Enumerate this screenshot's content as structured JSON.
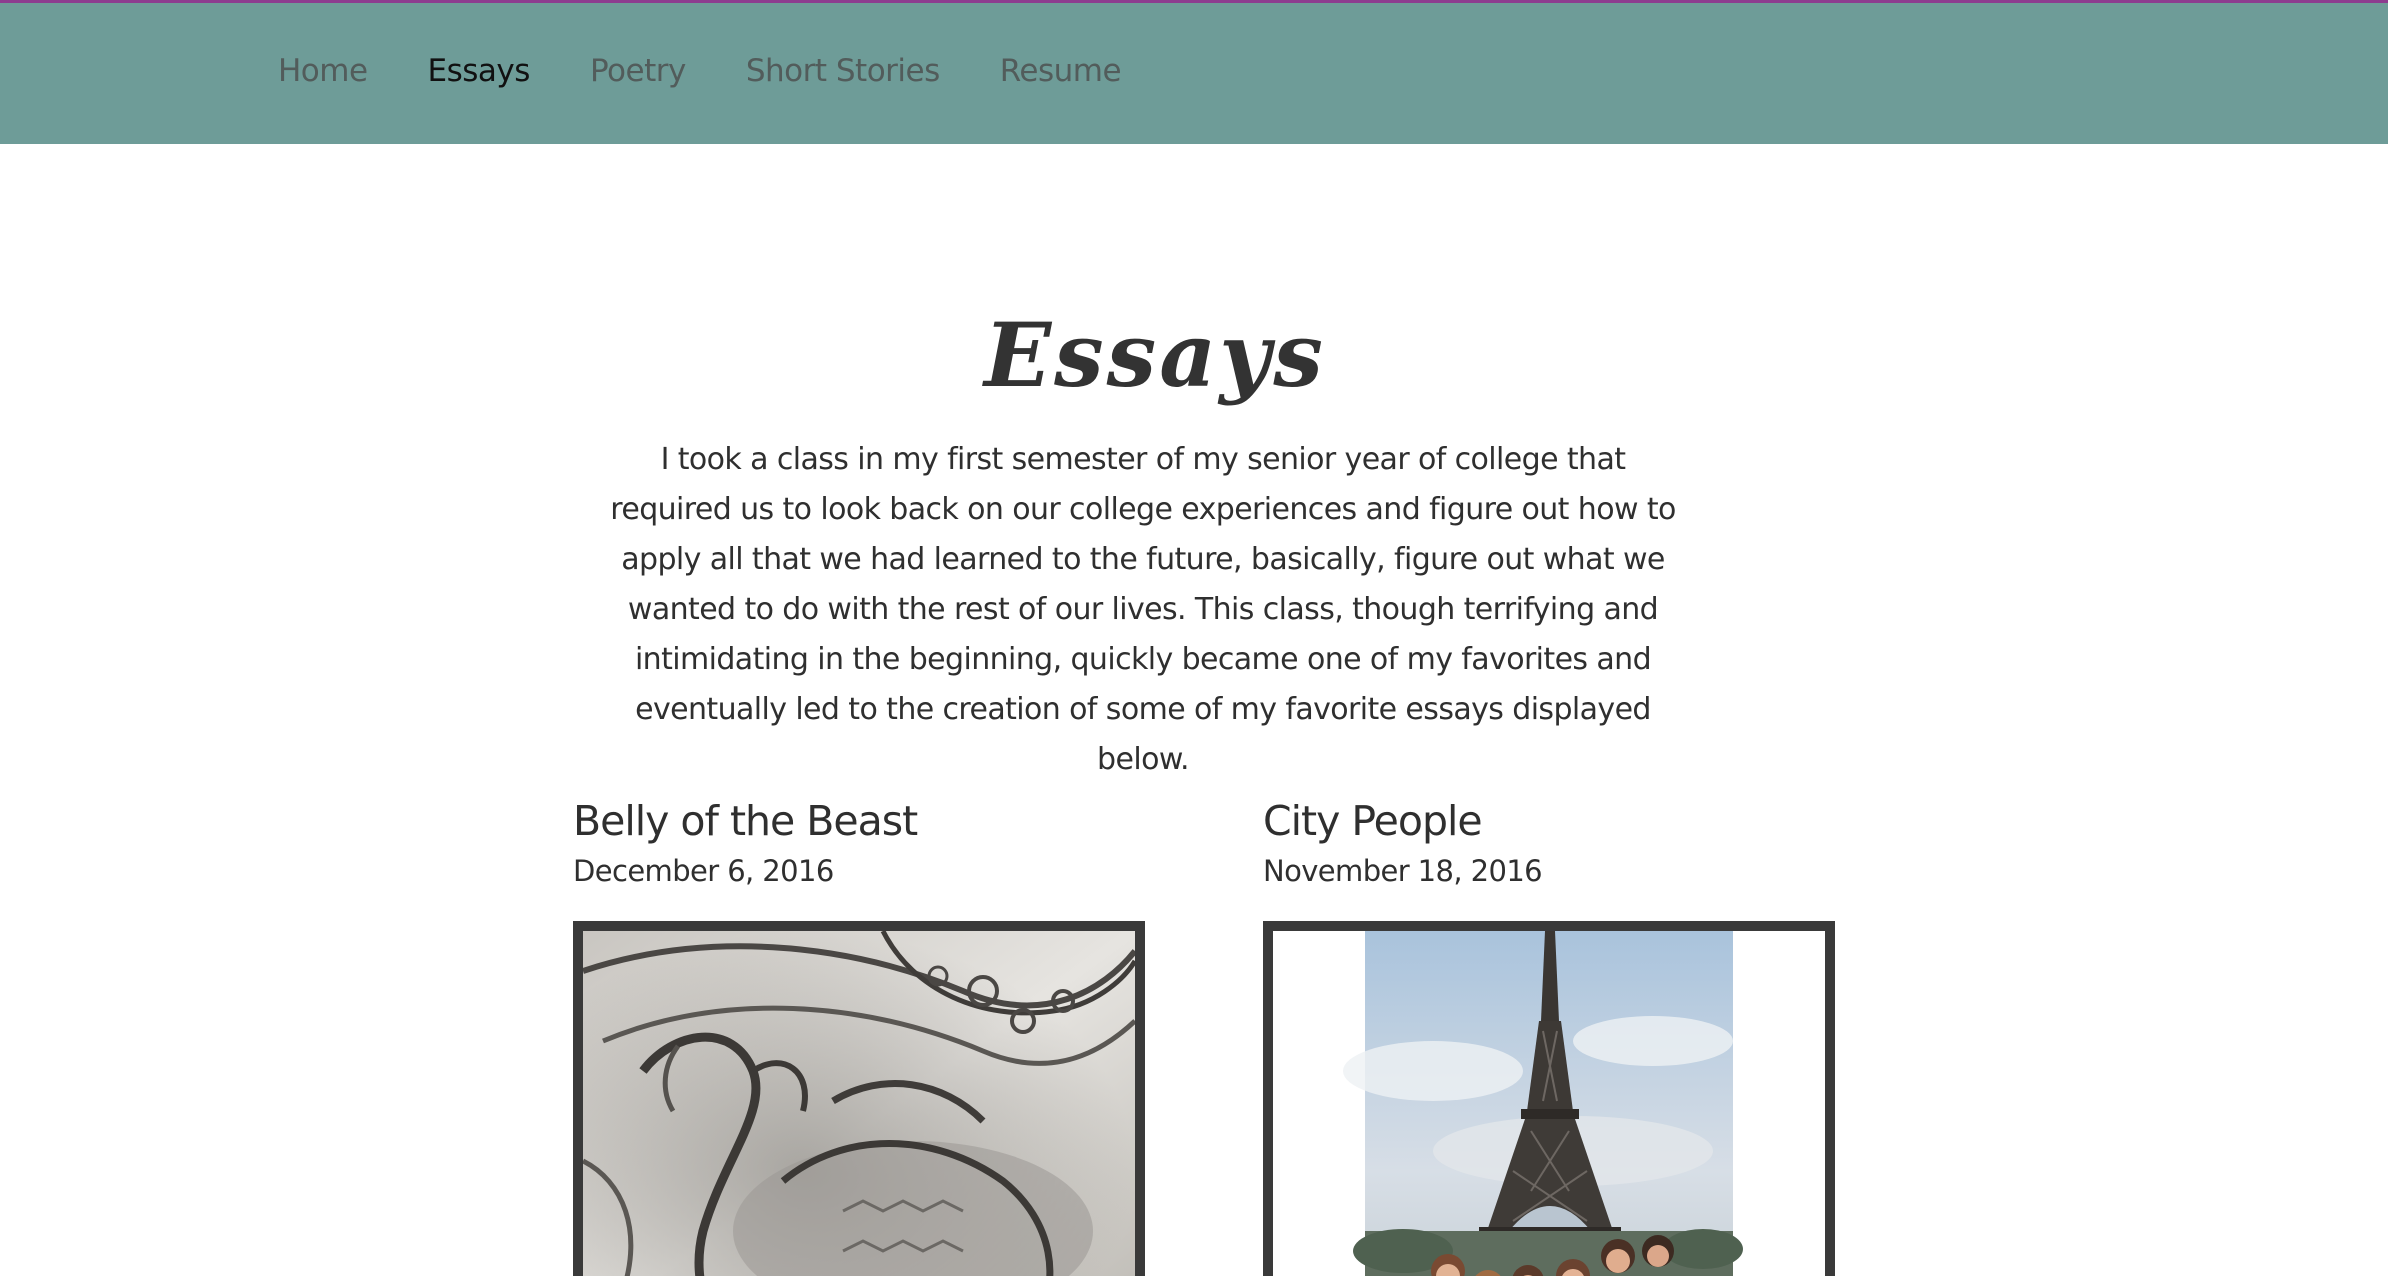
{
  "nav": {
    "items": [
      {
        "label": "Home"
      },
      {
        "label": "Essays"
      },
      {
        "label": "Poetry"
      },
      {
        "label": "Short Stories"
      },
      {
        "label": "Resume"
      }
    ],
    "active": "Essays"
  },
  "page": {
    "title": "Essays",
    "intro": "I took a class in my first semester of my senior year of college that required us to look back on our college experiences and figure out how to apply all that we had learned to the future, basically, figure out what we wanted to do with the rest of our lives. This class, though terrifying and intimidating in the beginning, quickly became one of my favorites and eventually led to the creation of some of my favorite essays displayed below."
  },
  "posts": [
    {
      "title": "Belly of the Beast",
      "date": "December 6, 2016",
      "image": "pencil-dragon-drawing"
    },
    {
      "title": "City People",
      "date": "November 18, 2016",
      "image": "eiffel-tower-group-photo"
    }
  ],
  "colors": {
    "nav_bg": "#6e9c98",
    "top_strip": "#8d3c8f",
    "frame": "#3a3a3a",
    "text": "#2f2f2f"
  }
}
